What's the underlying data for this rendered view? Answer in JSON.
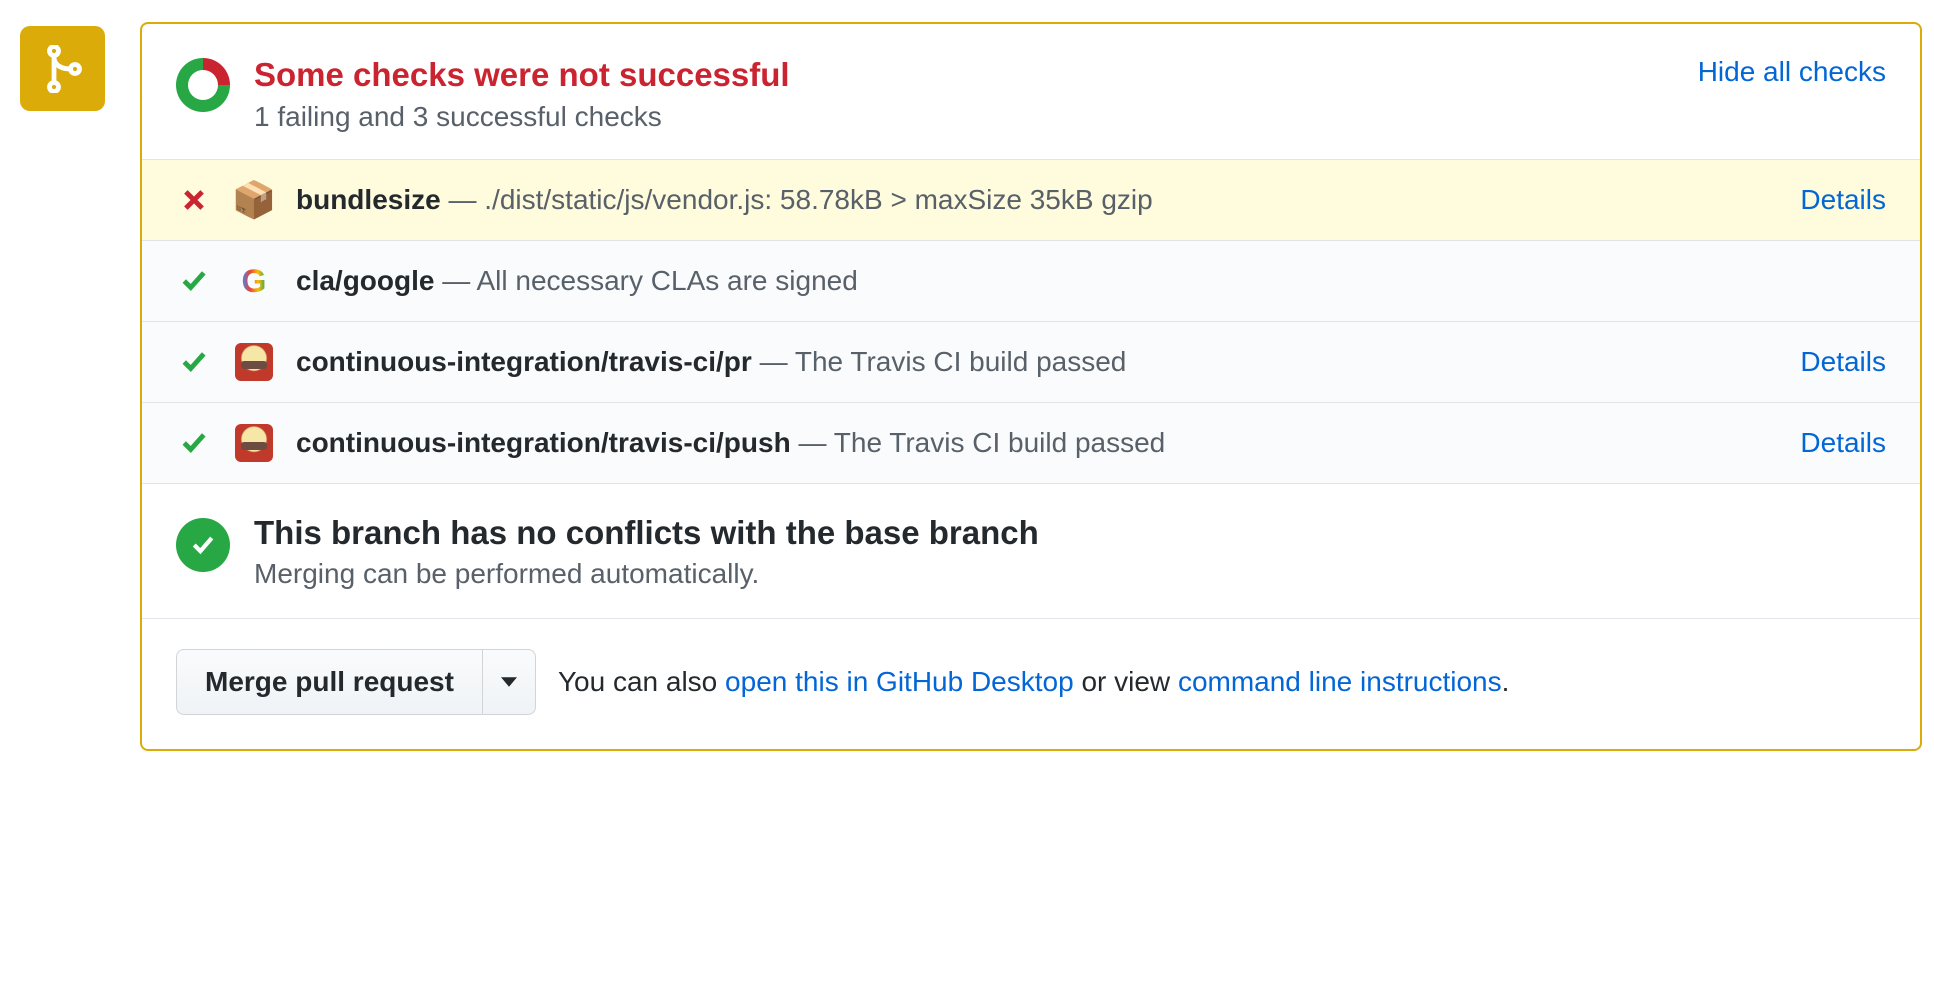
{
  "header": {
    "title": "Some checks were not successful",
    "subtitle": "1 failing and 3 successful checks",
    "hide_link": "Hide all checks"
  },
  "checks": [
    {
      "status": "fail",
      "icon": "package",
      "name": "bundlesize",
      "desc": "./dist/static/js/vendor.js: 58.78kB > maxSize 35kB gzip",
      "details": "Details"
    },
    {
      "status": "pass",
      "icon": "google",
      "name": "cla/google",
      "desc": "All necessary CLAs are signed",
      "details": ""
    },
    {
      "status": "pass",
      "icon": "travis",
      "name": "continuous-integration/travis-ci/pr",
      "desc": "The Travis CI build passed",
      "details": "Details"
    },
    {
      "status": "pass",
      "icon": "travis",
      "name": "continuous-integration/travis-ci/push",
      "desc": "The Travis CI build passed",
      "details": "Details"
    }
  ],
  "merge": {
    "title": "This branch has no conflicts with the base branch",
    "subtitle": "Merging can be performed automatically."
  },
  "actions": {
    "merge_button": "Merge pull request",
    "help_prefix": "You can also ",
    "desktop_link": "open this in GitHub Desktop",
    "help_middle": " or view ",
    "cli_link": "command line instructions",
    "help_suffix": "."
  }
}
